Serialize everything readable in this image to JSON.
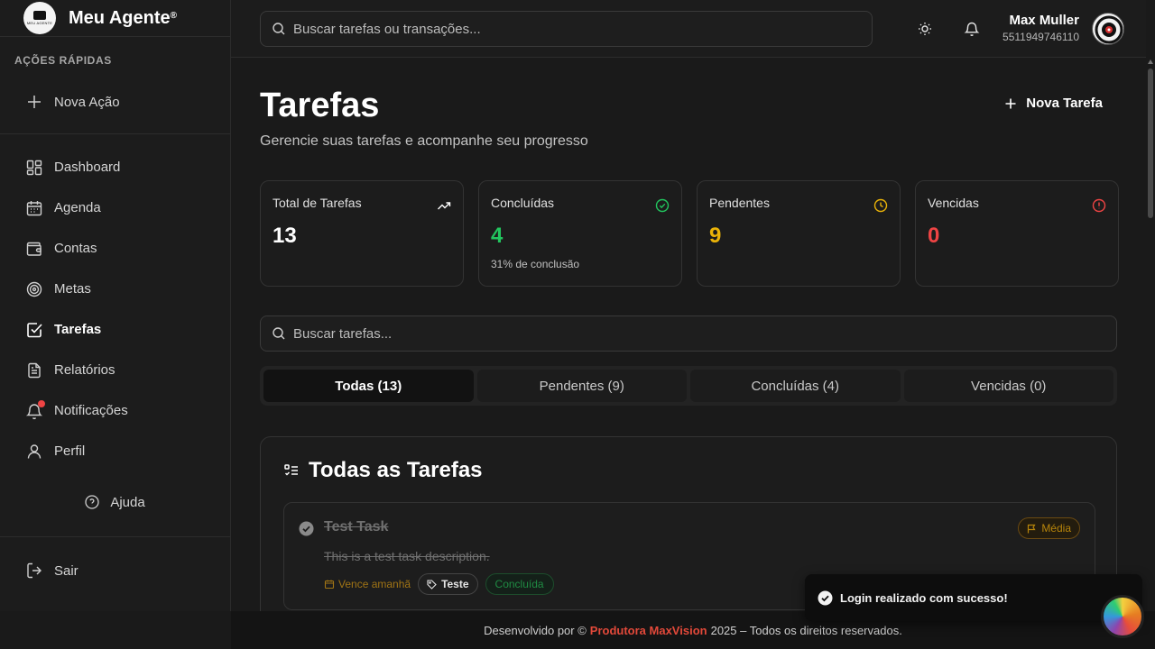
{
  "brand": {
    "name": "Meu Agente",
    "mark": "®",
    "logo_text": "MEU AGENTE"
  },
  "sidebar": {
    "section_title": "AÇÕES RÁPIDAS",
    "new_action": "Nova Ação",
    "items": [
      {
        "label": "Dashboard",
        "icon": "dashboard-icon"
      },
      {
        "label": "Agenda",
        "icon": "calendar-icon"
      },
      {
        "label": "Contas",
        "icon": "wallet-icon"
      },
      {
        "label": "Metas",
        "icon": "target-icon"
      },
      {
        "label": "Tarefas",
        "icon": "checkbox-icon",
        "active": true
      },
      {
        "label": "Relatórios",
        "icon": "report-icon"
      },
      {
        "label": "Notificações",
        "icon": "bell-icon",
        "has_dot": true
      },
      {
        "label": "Perfil",
        "icon": "user-icon"
      }
    ],
    "help": "Ajuda",
    "logout": "Sair"
  },
  "topbar": {
    "search_placeholder": "Buscar tarefas ou transações...",
    "user_name": "Max Muller",
    "user_phone": "5511949746110"
  },
  "page": {
    "title": "Tarefas",
    "subtitle": "Gerencie suas tarefas e acompanhe seu progresso",
    "new_task": "Nova Tarefa"
  },
  "stats": [
    {
      "label": "Total de Tarefas",
      "value": "13",
      "color": "#ffffff",
      "icon": "trending-up-icon"
    },
    {
      "label": "Concluídas",
      "value": "4",
      "color": "#22c55e",
      "note": "31% de conclusão",
      "icon": "check-circle-icon"
    },
    {
      "label": "Pendentes",
      "value": "9",
      "color": "#eab308",
      "icon": "clock-icon"
    },
    {
      "label": "Vencidas",
      "value": "0",
      "color": "#ef4444",
      "icon": "alert-circle-icon"
    }
  ],
  "task_search_placeholder": "Buscar tarefas...",
  "tabs": [
    {
      "label": "Todas (13)",
      "active": true
    },
    {
      "label": "Pendentes (9)"
    },
    {
      "label": "Concluídas (4)"
    },
    {
      "label": "Vencidas (0)"
    }
  ],
  "list": {
    "title": "Todas as Tarefas",
    "tasks": [
      {
        "title": "Test Task",
        "description": "This is a test task description.",
        "priority": "Média",
        "due": "Vence amanhã",
        "tag": "Teste",
        "status": "Concluída"
      }
    ]
  },
  "footer": {
    "prefix": "Desenvolvido por ©",
    "company": "Produtora MaxVision",
    "suffix": "2025 – Todos os direitos reservados."
  },
  "toast": {
    "message": "Login realizado com sucesso!"
  }
}
